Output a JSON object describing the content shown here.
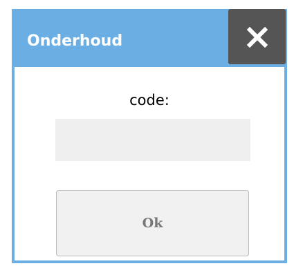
{
  "dialog": {
    "title": "Onderhoud",
    "close_icon": "close-icon",
    "code_label": "code:",
    "code_input": {
      "value": "",
      "placeholder": ""
    },
    "ok_label": "Ok"
  },
  "colors": {
    "titlebar": "#6aaee3",
    "close_button": "#555555",
    "input_background": "#efefef",
    "button_background": "#f1f1f1",
    "button_text": "#777777"
  }
}
